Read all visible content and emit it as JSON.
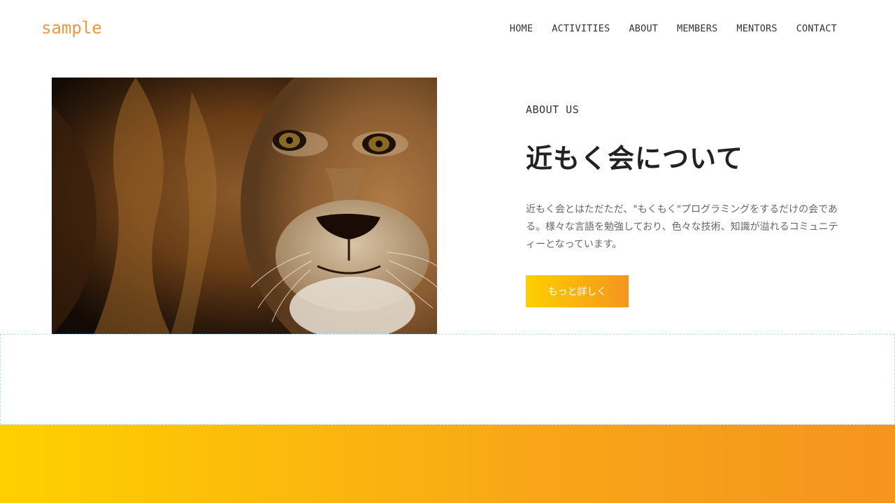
{
  "header": {
    "logo": "sample",
    "nav": [
      "HOME",
      "ACTIVITIES",
      "ABOUT",
      "MEMBERS",
      "MENTORS",
      "CONTACT"
    ]
  },
  "about": {
    "image_subject": "lion-photo",
    "eyebrow": "ABOUT US",
    "title": "近もく会について",
    "description": "近もく会とはただただ、\"もくもく\"プログラミングをするだけの会である。様々な言語を勉強しており、色々な技術、知識が溢れるコミュニティーとなっています。",
    "button_label": "もっと詳しく"
  },
  "colors": {
    "accent_orange": "#f0983a",
    "gradient_start": "#ffd000",
    "gradient_end": "#f5941f"
  }
}
